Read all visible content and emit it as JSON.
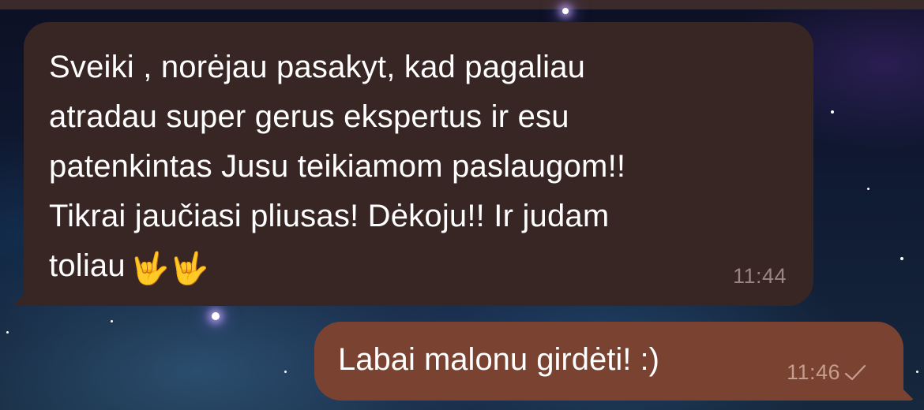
{
  "chat": {
    "messages": [
      {
        "direction": "incoming",
        "text": "Sveiki , norėjau pasakyt, kad pagaliau\natradau super gerus ekspertus ir esu\npatenkintas Jusu teikiamom paslaugom!!\nTikrai jaučiasi pliusas! Dėkoju!! Ir judam\ntoliau",
        "emoji": "🤟🤟",
        "time": "11:44"
      },
      {
        "direction": "outgoing",
        "text": "Labai malonu girdėti! :)",
        "time": "11:46",
        "status_icon": "single-check-icon"
      }
    ]
  },
  "colors": {
    "incoming_bubble": "#382625",
    "outgoing_bubble": "#7a4331",
    "text": "#ffffff",
    "incoming_time": "#9a8583",
    "outgoing_time": "#c59d8e"
  }
}
